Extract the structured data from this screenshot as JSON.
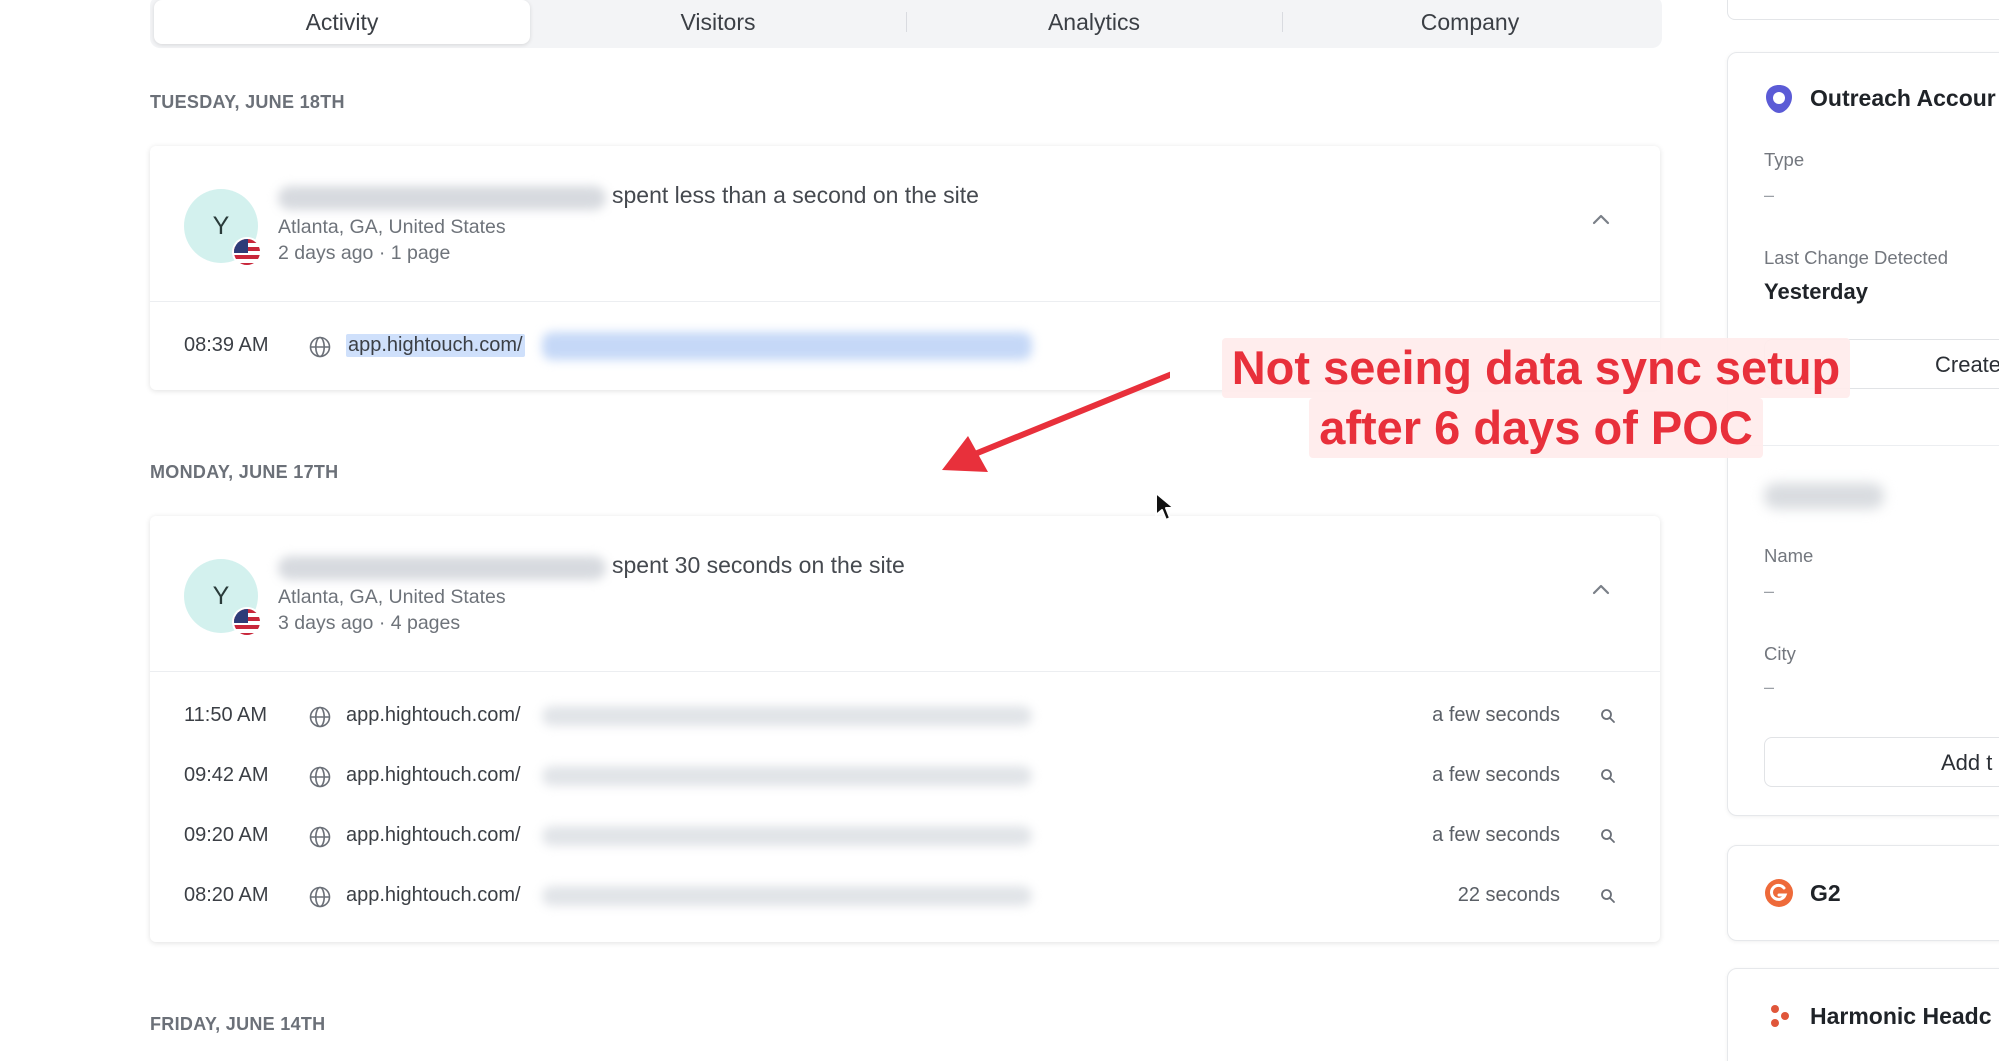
{
  "tabs": [
    {
      "label": "Activity"
    },
    {
      "label": "Visitors"
    },
    {
      "label": "Analytics"
    },
    {
      "label": "Company"
    }
  ],
  "days": [
    {
      "label": "TUESDAY, JUNE 18TH",
      "visit": {
        "avatar_initial": "Y",
        "headline": "spent less than a second on the site",
        "location": "Atlanta, GA, United States",
        "meta": "2 days ago · 1 page",
        "pages": [
          {
            "time": "08:39 AM",
            "url": "app.hightouch.com/",
            "duration": ""
          }
        ]
      }
    },
    {
      "label": "MONDAY, JUNE 17TH",
      "visit": {
        "avatar_initial": "Y",
        "headline": "spent 30 seconds on the site",
        "location": "Atlanta, GA, United States",
        "meta": "3 days ago · 4 pages",
        "pages": [
          {
            "time": "11:50 AM",
            "url": "app.hightouch.com/",
            "duration": "a few seconds"
          },
          {
            "time": "09:42 AM",
            "url": "app.hightouch.com/",
            "duration": "a few seconds"
          },
          {
            "time": "09:20 AM",
            "url": "app.hightouch.com/",
            "duration": "a few seconds"
          },
          {
            "time": "08:20 AM",
            "url": "app.hightouch.com/",
            "duration": "22 seconds"
          }
        ]
      }
    },
    {
      "label": "FRIDAY, JUNE 14TH"
    }
  ],
  "sidebar": {
    "outreach": {
      "title": "Outreach Accour",
      "type_label": "Type",
      "type_value": "–",
      "last_change_label": "Last Change Detected",
      "last_change_value": "Yesterday",
      "create_button": "Create"
    },
    "contact": {
      "name_label": "Name",
      "name_value": "–",
      "city_label": "City",
      "city_value": "–",
      "add_button": "Add t"
    },
    "g2": {
      "title": "G2"
    },
    "harmonic": {
      "title": "Harmonic Headc"
    }
  },
  "annotation": {
    "line1": "Not seeing data sync setup",
    "line2": "after 6 days of POC"
  },
  "colors": {
    "annotation": "#e8303b",
    "avatar_bg": "#d3f1ee",
    "url_highlight": "#cfe0fb",
    "outreach_icon": "#5b5bd6",
    "g2_icon": "#ee6a3a",
    "harmonic_icon": "#e0563a"
  }
}
